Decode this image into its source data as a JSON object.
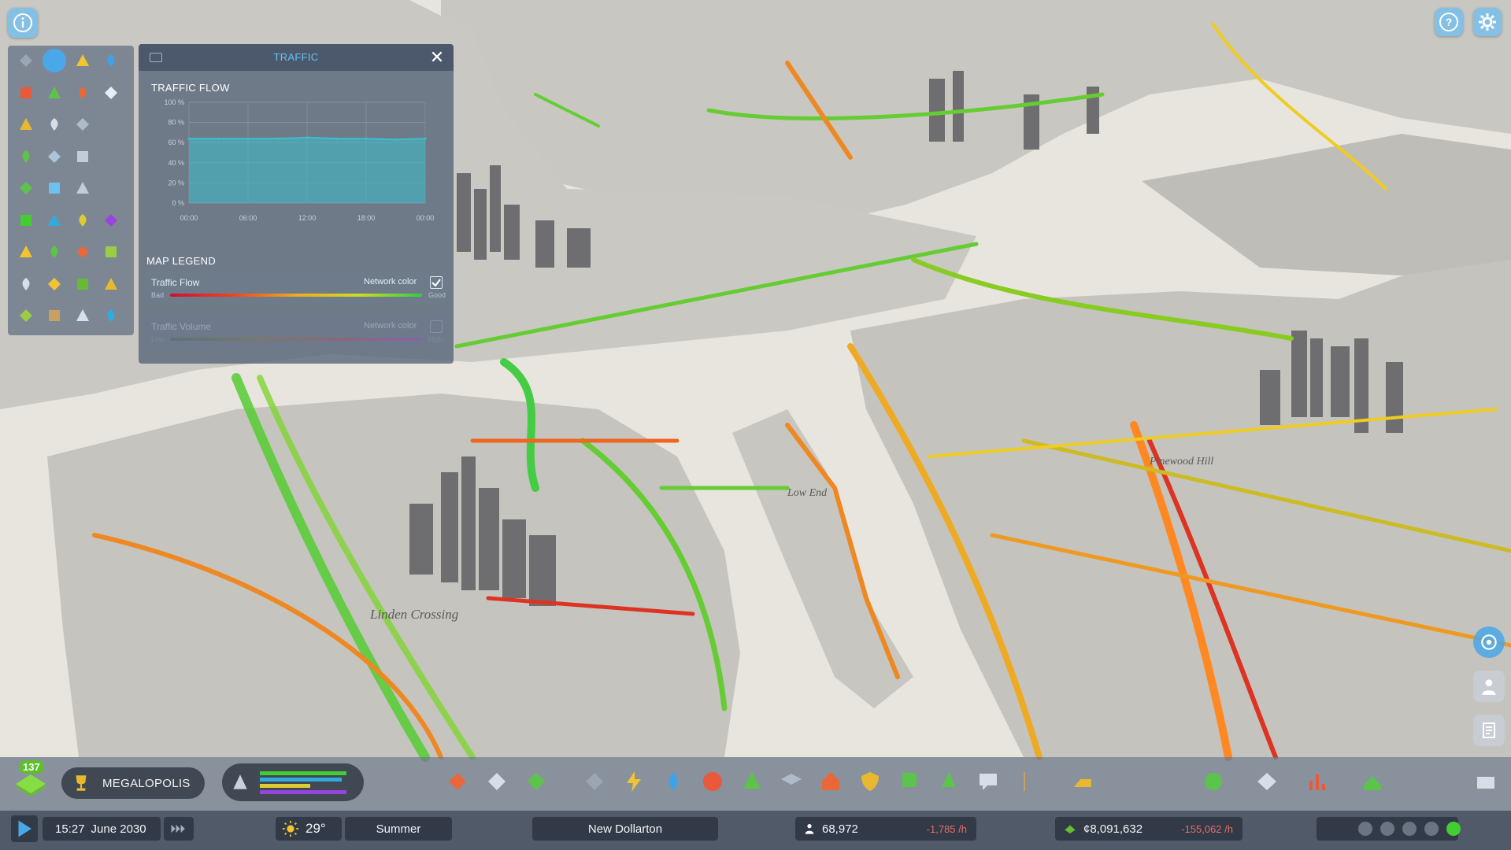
{
  "top_bar": {
    "info_icon": "info-icon",
    "help_icon": "help-icon",
    "settings_icon": "gear-icon"
  },
  "infoview_icons": [
    [
      "road-icon",
      "traffic-icon",
      "electricity-icon",
      "water-icon"
    ],
    [
      "fire-icon",
      "recycle-icon",
      "police-shield-icon",
      "wrench-icon"
    ],
    [
      "badge-icon",
      "education-building-icon",
      "graduation-cap-icon",
      ""
    ],
    [
      "bus-icon",
      "mail-icon",
      "chat-icon",
      ""
    ],
    [
      "tree-icon",
      "trash-bin-icon",
      "pipe-icon",
      ""
    ],
    [
      "residential-zone-icon",
      "commercial-zone-icon",
      "industrial-zone-icon",
      "office-zone-icon"
    ],
    [
      "house-icon",
      "leveling-icon",
      "transport-line-icon",
      "plant-icon"
    ],
    [
      "citizens-icon",
      "happiness-icon",
      "money-icon",
      "workers-icon"
    ],
    [
      "landscape-icon",
      "earth-icon",
      "headphones-icon",
      "water-level-icon"
    ]
  ],
  "traffic_panel": {
    "title": "TRAFFIC",
    "close": "✕",
    "flow_title": "TRAFFIC FLOW",
    "legend_title": "MAP LEGEND",
    "rows": [
      {
        "label": "Traffic Flow",
        "network_label": "Network color",
        "checked": true,
        "low": "Bad",
        "high": "Good"
      },
      {
        "label": "Traffic Volume",
        "network_label": "Network color",
        "checked": false,
        "low": "Low",
        "high": "High"
      }
    ]
  },
  "chart_data": {
    "type": "area",
    "title": "TRAFFIC FLOW",
    "x_ticks": [
      "00:00",
      "06:00",
      "12:00",
      "18:00",
      "00:00"
    ],
    "y_ticks": [
      "100 %",
      "80 %",
      "60 %",
      "40 %",
      "20 %",
      "0 %"
    ],
    "ylim": [
      0,
      100
    ],
    "x": [
      0,
      3,
      6,
      9,
      12,
      15,
      18,
      21,
      24
    ],
    "values": [
      64,
      64,
      64,
      64,
      65,
      64,
      64,
      63,
      64
    ],
    "color": "#3bbfcc"
  },
  "map_labels": {
    "linden": "Linden Crossing",
    "low_end": "Low End",
    "pinewood": "Pinewood Hill"
  },
  "bottom": {
    "milestone_count": "137",
    "milestone_name": "MEGALOPOLIS",
    "time": "15:27",
    "date": "June 2030",
    "temperature": "29°",
    "season": "Summer",
    "city_name": "New Dollarton",
    "population": "68,972",
    "population_change": "-1,785 /h",
    "money": "¢8,091,632",
    "money_change": "-155,062 /h"
  },
  "colors": {
    "accent": "#4aa8e8",
    "good": "#22cc33",
    "bad": "#dd2222",
    "panel": "#58667a"
  }
}
